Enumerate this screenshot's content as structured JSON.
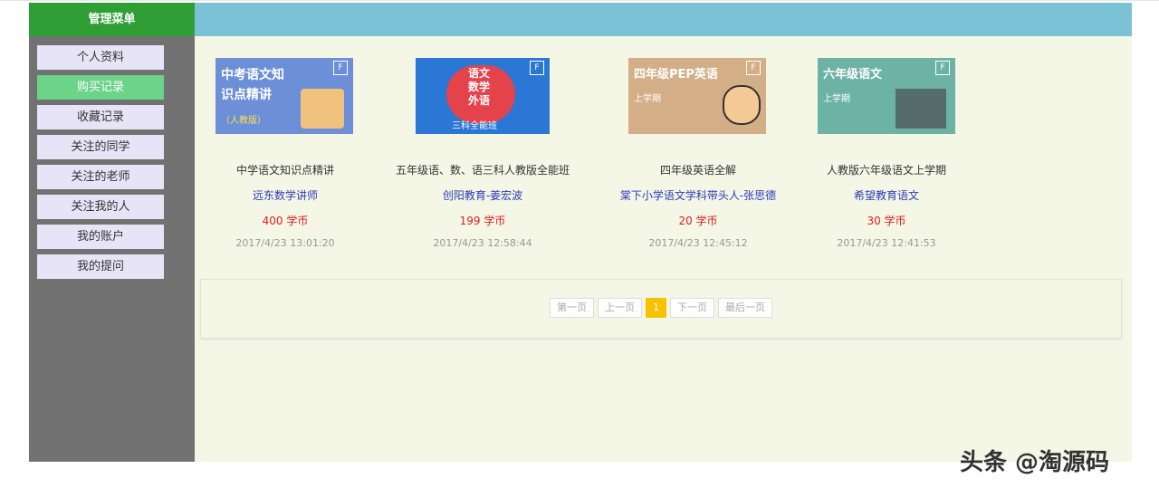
{
  "sidebar": {
    "header": "管理菜单",
    "items": [
      {
        "label": "个人资料"
      },
      {
        "label": "购买记录"
      },
      {
        "label": "收藏记录"
      },
      {
        "label": "关注的同学"
      },
      {
        "label": "关注的老师"
      },
      {
        "label": "关注我的人"
      },
      {
        "label": "我的账户"
      },
      {
        "label": "我的提问"
      }
    ],
    "active_index": 1
  },
  "courses": [
    {
      "thumb_title_1": "中考语文知",
      "thumb_title_2": "识点精讲",
      "thumb_sub": "（人教版）",
      "thumb_color": "#6d8fd8",
      "title": "中学语文知识点精讲",
      "teacher": "远东数学讲师",
      "price": "400 学币",
      "date": "2017/4/23 13:01:20"
    },
    {
      "thumb_title_1": "语文",
      "thumb_title_2": "数学",
      "thumb_title_3": "外语",
      "thumb_sub": "三科全能班",
      "thumb_color": "#2a77d6",
      "title": "五年级语、数、语三科人教版全能班",
      "teacher": "创阳教育-姜宏波",
      "price": "199 学币",
      "date": "2017/4/23 12:58:44"
    },
    {
      "thumb_title_1": "四年级PEP英语",
      "thumb_sub": "上学期",
      "thumb_color": "#d4ae86",
      "title": "四年级英语全解",
      "teacher": "棠下小学语文学科带头人-张思德",
      "price": "20 学币",
      "date": "2017/4/23 12:45:12"
    },
    {
      "thumb_title_1": "六年级语文",
      "thumb_sub": "上学期",
      "thumb_color": "#6db3a5",
      "title": "人教版六年级语文上学期",
      "teacher": "希望教育语文",
      "price": "30 学币",
      "date": "2017/4/23 12:41:53"
    }
  ],
  "pagination": {
    "first": "第一页",
    "prev": "上一页",
    "current": "1",
    "next": "下一页",
    "last": "最后一页"
  },
  "watermark": "头条 @淘源码",
  "colors": {
    "sidebar_header": "#2f9e34",
    "topbar": "#7cc2d6",
    "sidebar_bg": "#727272",
    "active_item": "#6bd488",
    "content_bg": "#f4f6e6",
    "price": "#e02020",
    "teacher_link": "#2b3bbd",
    "current_page": "#f6c200"
  }
}
